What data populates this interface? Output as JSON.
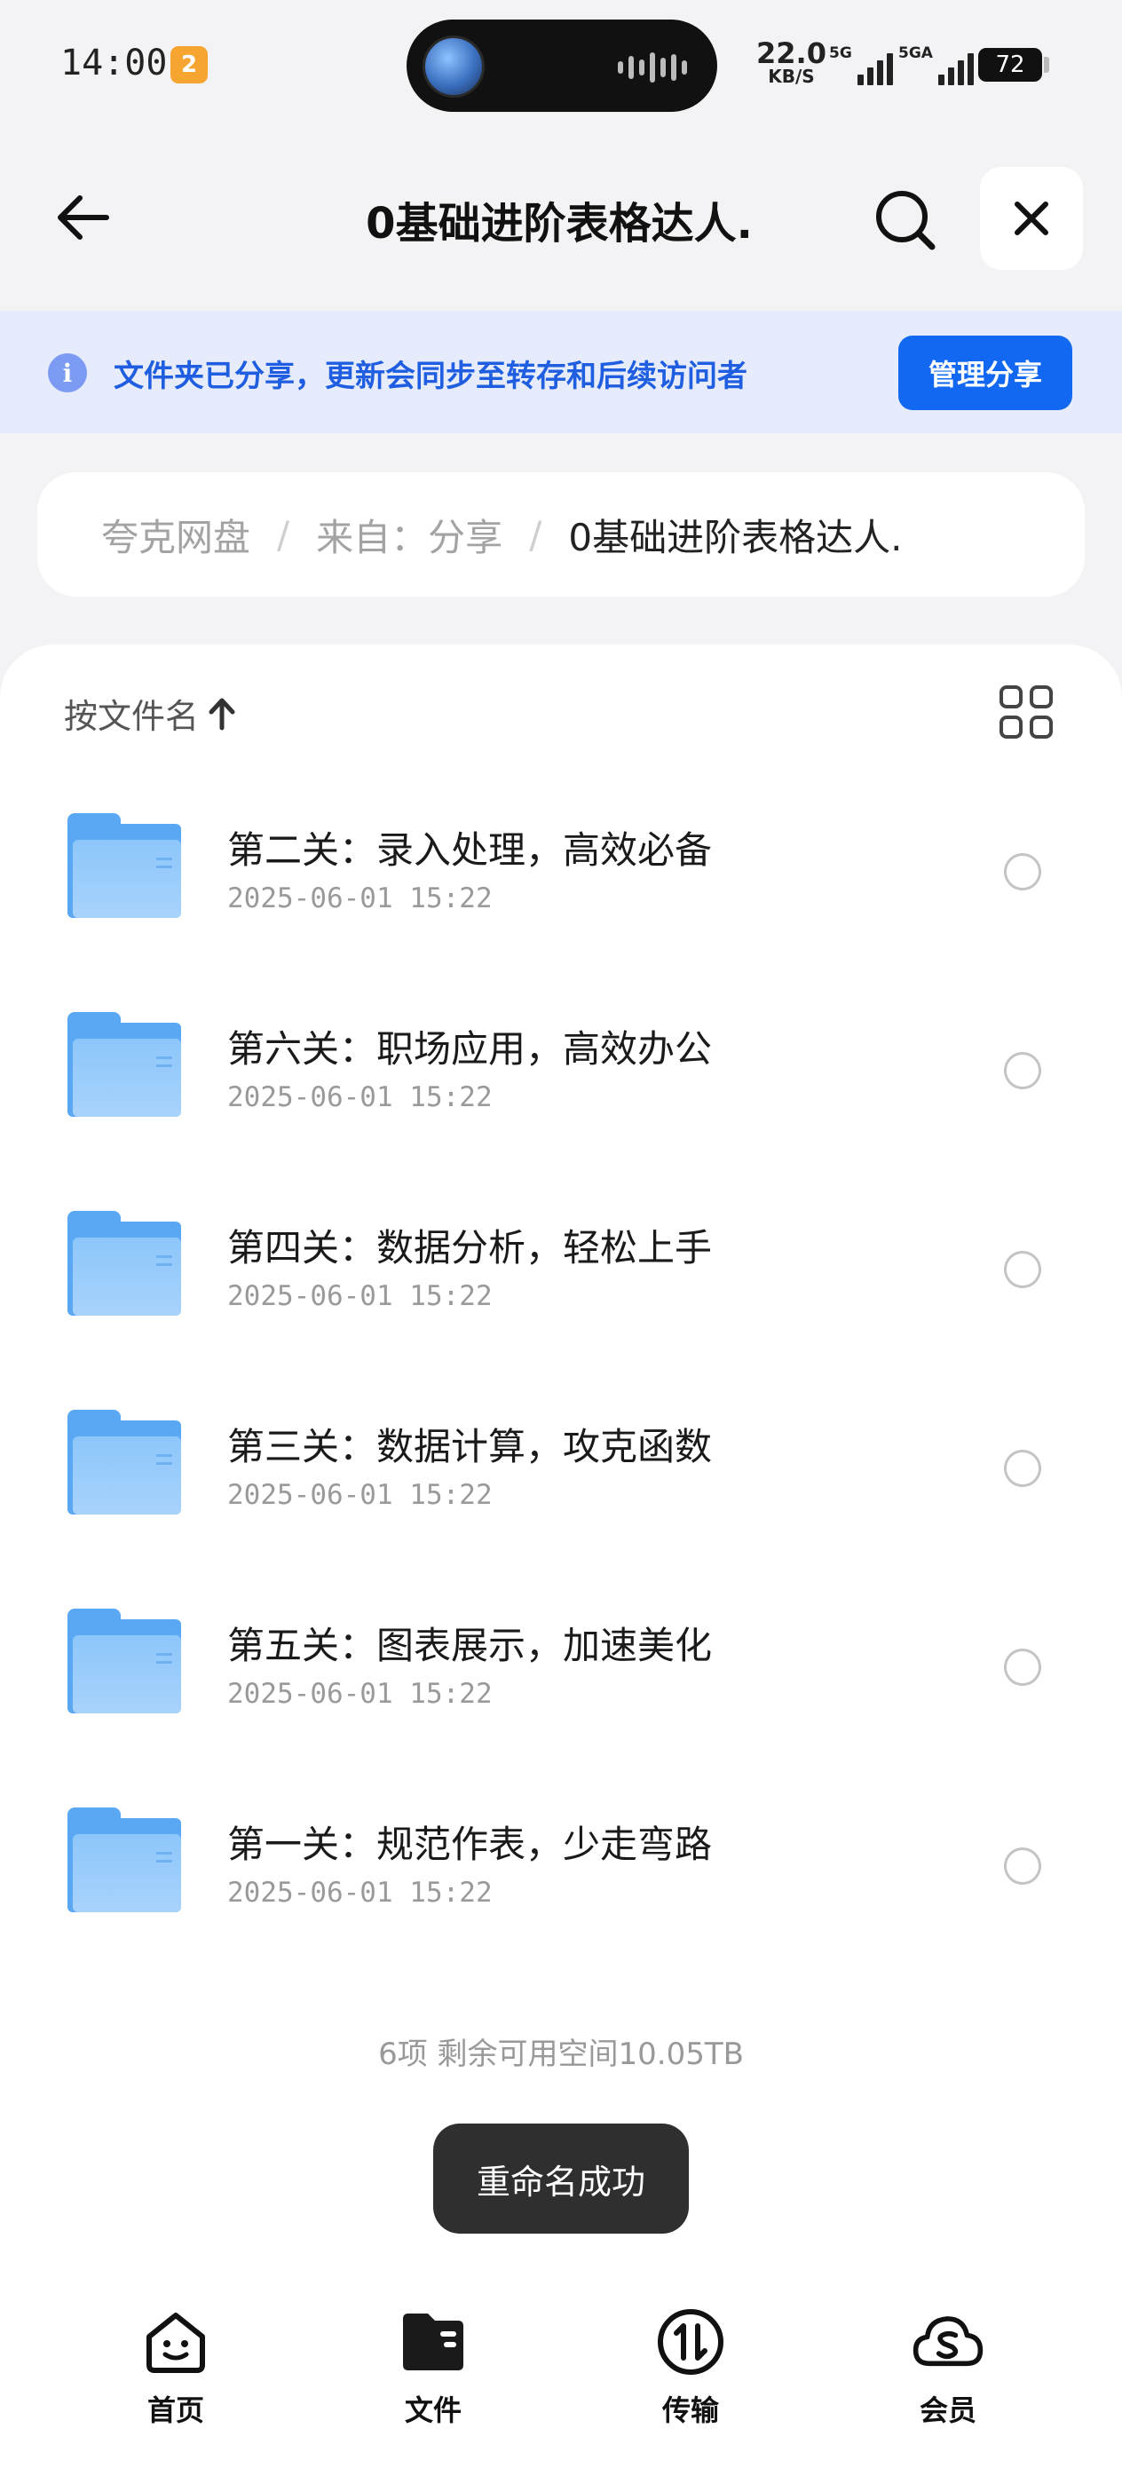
{
  "status_bar": {
    "time": "14:00",
    "app_badge": "2",
    "net_speed": "22.0",
    "net_unit": "KB/S",
    "sim1_label": "5G",
    "sim2_label": "5GA",
    "battery": "72"
  },
  "header": {
    "title": "0基础进阶表格达人.",
    "back_icon": "arrow-left-icon",
    "search_icon": "search-icon",
    "close_icon": "close-icon"
  },
  "share_banner": {
    "icon": "info-icon",
    "text": "文件夹已分享，更新会同步至转存和后续访问者",
    "manage_label": "管理分享",
    "accent_color": "#1268f0"
  },
  "breadcrumb": {
    "items": [
      "夸克网盘",
      "来自：分享",
      "0基础进阶表格达人."
    ],
    "separator": "/"
  },
  "toolbar": {
    "sort_label": "按文件名",
    "sort_direction_icon": "arrow-up-icon",
    "view_toggle_icon": "grid-view-icon"
  },
  "files": [
    {
      "name": "第二关：录入处理，高效必备",
      "date": "2025-06-01 15:22"
    },
    {
      "name": "第六关：职场应用，高效办公",
      "date": "2025-06-01 15:22"
    },
    {
      "name": "第四关：数据分析，轻松上手",
      "date": "2025-06-01 15:22"
    },
    {
      "name": "第三关：数据计算，攻克函数",
      "date": "2025-06-01 15:22"
    },
    {
      "name": "第五关：图表展示，加速美化",
      "date": "2025-06-01 15:22"
    },
    {
      "name": "第一关：规范作表，少走弯路",
      "date": "2025-06-01 15:22"
    }
  ],
  "summary": "6项 剩余可用空间10.05TB",
  "toast": "重命名成功",
  "bottom_nav": {
    "items": [
      {
        "label": "首页",
        "icon": "home-icon"
      },
      {
        "label": "文件",
        "icon": "files-icon"
      },
      {
        "label": "传输",
        "icon": "transfer-icon"
      },
      {
        "label": "会员",
        "icon": "vip-icon"
      }
    ]
  }
}
